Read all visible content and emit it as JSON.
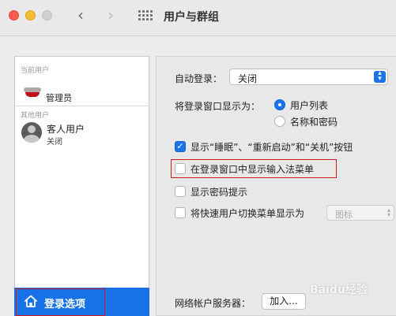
{
  "window": {
    "title": "用户与群组",
    "back_icon": "chevron-left-icon",
    "forward_icon": "chevron-right-icon",
    "grid_icon": "show-all-grid-icon"
  },
  "sidebar": {
    "current_user_header": "当前用户",
    "current_user_role": "管理员",
    "other_users_header": "其他用户",
    "guest_name": "客人用户",
    "guest_status": "关闭",
    "login_options_label": "登录选项",
    "login_options_icon": "home-icon",
    "selected_color": "#1672e6"
  },
  "main": {
    "auto_login_label": "自动登录：",
    "auto_login_value": "关闭",
    "display_login_as_label": "将登录窗口显示为：",
    "radio_user_list": "用户列表",
    "radio_name_password": "名称和密码",
    "radio_selected": "用户列表",
    "show_buttons_label": "显示“睡眠”、“重新启动”和“关机”按钮",
    "show_buttons_checked": true,
    "show_input_menu_label": "在登录窗口中显示输入法菜单",
    "show_input_menu_checked": false,
    "show_password_hints_label": "显示密码提示",
    "show_password_hints_checked": false,
    "fast_user_switch_label": "将快速用户切换菜单显示为",
    "fast_user_switch_checked": false,
    "fast_user_switch_value": "图标",
    "network_server_label": "网络帐户服务器：",
    "add_button_label": "加入...",
    "accent_color": "#1a73e8"
  },
  "annotation": {
    "highlight_color": "#d0181e"
  },
  "watermark": {
    "text": "Baidu经验"
  }
}
